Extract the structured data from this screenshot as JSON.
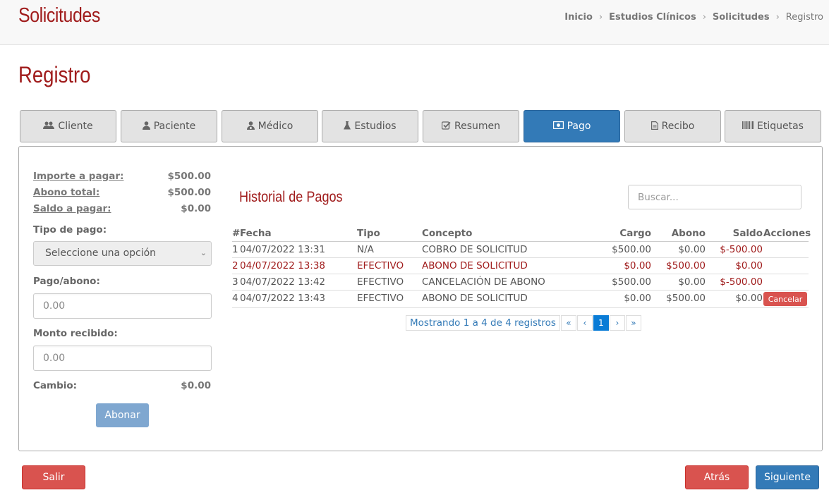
{
  "header": {
    "title": "Solicitudes",
    "breadcrumb": [
      "Inicio",
      "Estudios Clínicos",
      "Solicitudes",
      "Registro"
    ]
  },
  "page_title": "Registro",
  "tabs": [
    {
      "label": "Cliente",
      "icon": "users-icon"
    },
    {
      "label": "Paciente",
      "icon": "user-icon"
    },
    {
      "label": "Médico",
      "icon": "doctor-icon"
    },
    {
      "label": "Estudios",
      "icon": "flask-icon"
    },
    {
      "label": "Resumen",
      "icon": "check-square-icon"
    },
    {
      "label": "Pago",
      "icon": "money-icon",
      "active": true
    },
    {
      "label": "Recibo",
      "icon": "file-icon"
    },
    {
      "label": "Etiquetas",
      "icon": "barcode-icon"
    }
  ],
  "summary": {
    "importe_label": "Importe a pagar:",
    "importe_value": "$500.00",
    "abono_label": "Abono total:",
    "abono_value": "$500.00",
    "saldo_label": "Saldo a pagar:",
    "saldo_value": "$0.00"
  },
  "form": {
    "tipo_label": "Tipo de pago:",
    "tipo_value": "Seleccione una opción",
    "pago_label": "Pago/abono:",
    "pago_value": "0.00",
    "monto_label": "Monto recibido:",
    "monto_value": "0.00",
    "cambio_label": "Cambio:",
    "cambio_value": "$0.00",
    "abonar_label": "Abonar"
  },
  "historial": {
    "title": "Historial de Pagos",
    "search_placeholder": "Buscar...",
    "columns": {
      "num": "#",
      "fecha": "Fecha",
      "tipo": "Tipo",
      "concepto": "Concepto",
      "cargo": "Cargo",
      "abono": "Abono",
      "saldo": "Saldo",
      "acciones": "Acciones"
    },
    "rows": [
      {
        "num": "1",
        "fecha": "04/07/2022 13:31",
        "tipo": "N/A",
        "concepto": "COBRO DE SOLICITUD",
        "cargo": "$500.00",
        "abono": "$0.00",
        "saldo": "$-500.00"
      },
      {
        "num": "2",
        "fecha": "04/07/2022 13:38",
        "tipo": "EFECTIVO",
        "concepto": "ABONO DE SOLICITUD",
        "cargo": "$0.00",
        "abono": "$500.00",
        "saldo": "$0.00"
      },
      {
        "num": "3",
        "fecha": "04/07/2022 13:42",
        "tipo": "EFECTIVO",
        "concepto": "CANCELACIÓN DE ABONO",
        "cargo": "$500.00",
        "abono": "$0.00",
        "saldo": "$-500.00"
      },
      {
        "num": "4",
        "fecha": "04/07/2022 13:43",
        "tipo": "EFECTIVO",
        "concepto": "ABONO DE SOLICITUD",
        "cargo": "$0.00",
        "abono": "$500.00",
        "saldo": "$0.00",
        "action": "Cancelar"
      }
    ],
    "pager": {
      "info": "Mostrando 1 a 4 de 4 registros",
      "first": "«",
      "prev": "‹",
      "page": "1",
      "next": "›",
      "last": "»"
    }
  },
  "footer": {
    "salir": "Salir",
    "atras": "Atrás",
    "siguiente": "Siguiente"
  },
  "colors": {
    "accent_red": "#a01c1c",
    "primary_blue": "#337ab7",
    "danger": "#d9534f"
  }
}
